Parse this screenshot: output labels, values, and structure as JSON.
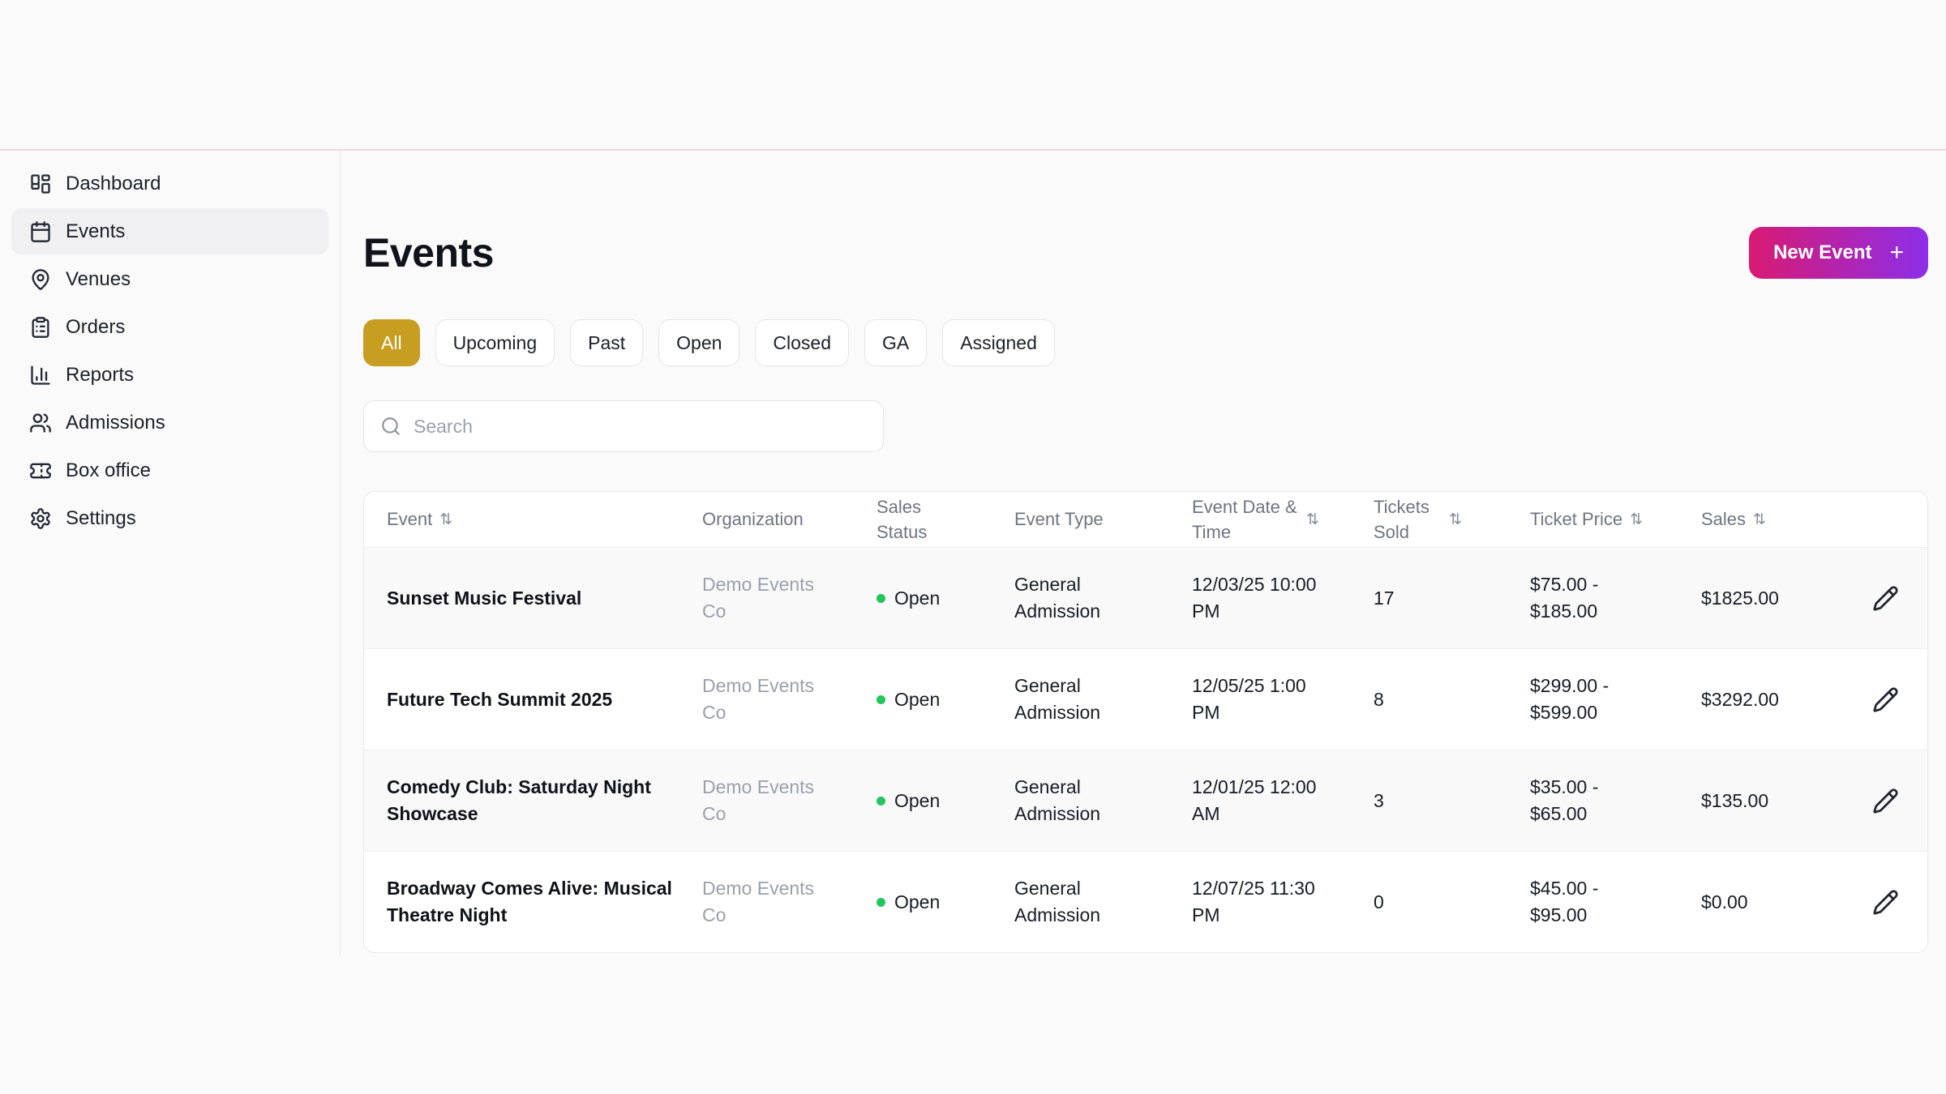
{
  "sidebar": {
    "items": [
      {
        "label": "Dashboard"
      },
      {
        "label": "Events",
        "active": true
      },
      {
        "label": "Venues"
      },
      {
        "label": "Orders"
      },
      {
        "label": "Reports"
      },
      {
        "label": "Admissions"
      },
      {
        "label": "Box office"
      },
      {
        "label": "Settings"
      }
    ]
  },
  "header": {
    "title": "Events",
    "new_event_button": {
      "label": "New Event",
      "plus_glyph": "+"
    }
  },
  "filters": {
    "chips": [
      {
        "label": "All",
        "active": true
      },
      {
        "label": "Upcoming"
      },
      {
        "label": "Past"
      },
      {
        "label": "Open"
      },
      {
        "label": "Closed"
      },
      {
        "label": "GA"
      },
      {
        "label": "Assigned"
      }
    ]
  },
  "search": {
    "placeholder": "Search"
  },
  "table": {
    "sort_glyph": "⇅",
    "columns": [
      {
        "label": "Event",
        "sortable": true
      },
      {
        "label": "Organization",
        "sortable": false
      },
      {
        "label": "Sales Status",
        "sortable": false
      },
      {
        "label": "Event Type",
        "sortable": false
      },
      {
        "label": "Event Date & Time",
        "sortable": true
      },
      {
        "label": "Tickets Sold",
        "sortable": true
      },
      {
        "label": "Ticket Price",
        "sortable": true
      },
      {
        "label": "Sales",
        "sortable": true
      }
    ],
    "rows": [
      {
        "event": "Sunset Music Festival",
        "organization": "Demo Events Co",
        "sales_status": "Open",
        "event_type": "General Admission",
        "date_time": "12/03/25 10:00 PM",
        "tickets_sold": "17",
        "ticket_price": "$75.00 - $185.00",
        "sales": "$1825.00"
      },
      {
        "event": "Future Tech Summit 2025",
        "organization": "Demo Events Co",
        "sales_status": "Open",
        "event_type": "General Admission",
        "date_time": "12/05/25 1:00 PM",
        "tickets_sold": "8",
        "ticket_price": "$299.00 - $599.00",
        "sales": "$3292.00"
      },
      {
        "event": "Comedy Club: Saturday Night Showcase",
        "organization": "Demo Events Co",
        "sales_status": "Open",
        "event_type": "General Admission",
        "date_time": "12/01/25 12:00 AM",
        "tickets_sold": "3",
        "ticket_price": "$35.00 - $65.00",
        "sales": "$135.00"
      },
      {
        "event": "Broadway Comes Alive: Musical Theatre Night",
        "organization": "Demo Events Co",
        "sales_status": "Open",
        "event_type": "General Admission",
        "date_time": "12/07/25 11:30 PM",
        "tickets_sold": "0",
        "ticket_price": "$45.00 - $95.00",
        "sales": "$0.00"
      }
    ]
  },
  "colors": {
    "active_filter_gold": "#c79e21",
    "new_event_gradient_start": "#d91a72",
    "new_event_gradient_end": "#8d2ee9",
    "status_open_green": "#22c55e",
    "top_divider_pink": "#f7d7da"
  }
}
